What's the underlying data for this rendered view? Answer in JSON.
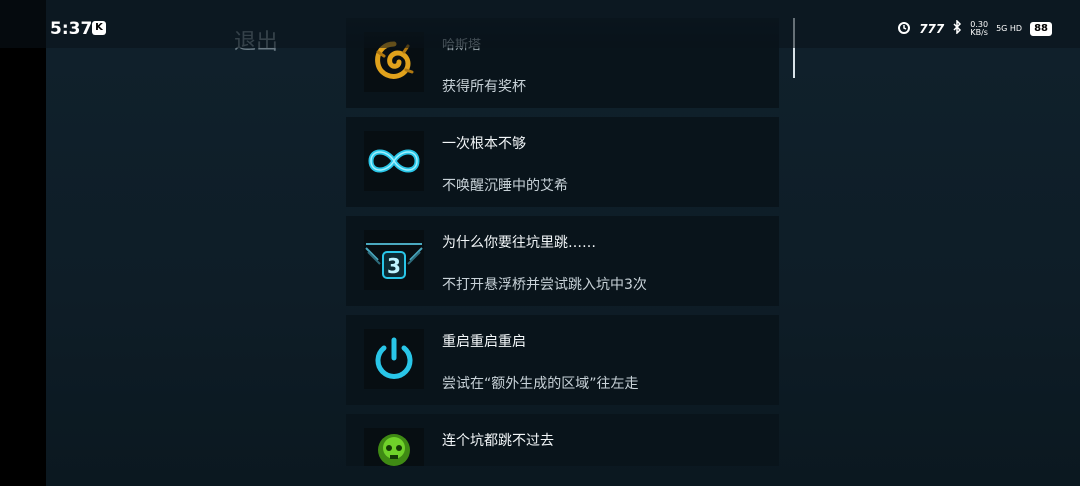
{
  "status_bar": {
    "time": "5:37",
    "k_badge": "K",
    "alarm_icon": "alarm-icon",
    "signal_brand": "777",
    "bluetooth_icon": "bluetooth-icon",
    "net_rate": "0.30",
    "net_unit": "KB/s",
    "network": "5G HD",
    "battery": "88"
  },
  "header": {
    "exit_label": "退出"
  },
  "achievements": [
    {
      "icon": "gold-swirl-icon",
      "title": "哈斯塔",
      "desc": "获得所有奖杯"
    },
    {
      "icon": "infinity-icon",
      "title": "一次根本不够",
      "desc": "不唤醒沉睡中的艾希"
    },
    {
      "icon": "pit-three-icon",
      "title": "为什么你要往坑里跳……",
      "desc": "不打开悬浮桥并尝试跳入坑中3次",
      "badge": "3"
    },
    {
      "icon": "power-icon",
      "title": "重启重启重启",
      "desc": "尝试在“额外生成的区域”往左走"
    },
    {
      "icon": "green-skull-icon",
      "title": "连个坑都跳不过去",
      "desc": ""
    }
  ],
  "colors": {
    "accent_cyan": "#29c6e8",
    "gold": "#e0a21c",
    "green": "#6fd22a"
  }
}
